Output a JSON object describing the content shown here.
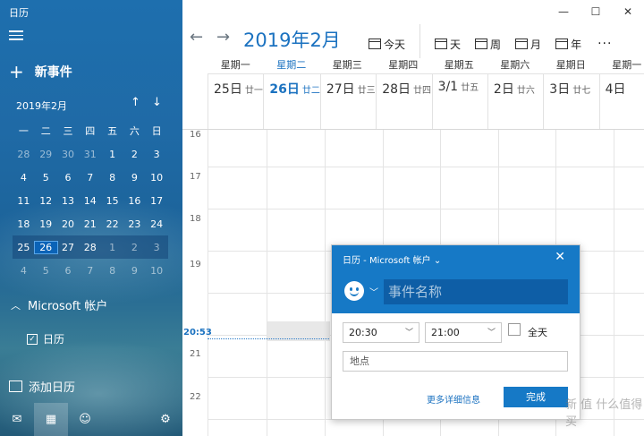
{
  "app": {
    "title": "日历"
  },
  "window": {
    "minimize": "—",
    "maximize": "☐",
    "close": "✕"
  },
  "left": {
    "new_event": "新事件",
    "mini_calendar": {
      "month_label": "2019年2月",
      "prev": "↑",
      "next": "↓",
      "weekdays": [
        "一",
        "二",
        "三",
        "四",
        "五",
        "六",
        "日"
      ],
      "weeks": [
        [
          "28",
          "29",
          "30",
          "31",
          "1",
          "2",
          "3"
        ],
        [
          "4",
          "5",
          "6",
          "7",
          "8",
          "9",
          "10"
        ],
        [
          "11",
          "12",
          "13",
          "14",
          "15",
          "16",
          "17"
        ],
        [
          "18",
          "19",
          "20",
          "21",
          "22",
          "23",
          "24"
        ],
        [
          "25",
          "26",
          "27",
          "28",
          "1",
          "2",
          "3"
        ],
        [
          "4",
          "5",
          "6",
          "7",
          "8",
          "9",
          "10"
        ]
      ]
    },
    "account": "Microsoft 帐户",
    "calendar_item": "日历",
    "add_calendar": "添加日历"
  },
  "toolbar": {
    "month_title": "2019年2月",
    "prev": "←",
    "next": "→",
    "today": "今天",
    "day": "天",
    "week": "周",
    "month": "月",
    "year": "年",
    "more": "···"
  },
  "week": {
    "day_names": [
      "星期一",
      "星期二",
      "星期三",
      "星期四",
      "星期五",
      "星期六",
      "星期日",
      "星期一"
    ],
    "dates": [
      {
        "num": "25日",
        "lunar": "廿一"
      },
      {
        "num": "26日",
        "lunar": "廿二"
      },
      {
        "num": "27日",
        "lunar": "廿三"
      },
      {
        "num": "28日",
        "lunar": "廿四"
      },
      {
        "num": "3/1",
        "lunar": "廿五"
      },
      {
        "num": "2日",
        "lunar": "廿六"
      },
      {
        "num": "3日",
        "lunar": "廿七"
      },
      {
        "num": "4日",
        "lunar": ""
      }
    ],
    "hours": [
      "16",
      "17",
      "18",
      "19",
      "21",
      "22"
    ],
    "now_time": "20:53"
  },
  "popup": {
    "calendar_label": "日历 - Microsoft 帐户 ⌄",
    "close": "✕",
    "name_placeholder": "事件名称",
    "start_time": "20:30",
    "end_time": "21:00",
    "all_day": "全天",
    "location_placeholder": "地点",
    "more_details": "更多详细信息",
    "done": "完成"
  },
  "watermark": "新 值 什么值得买"
}
